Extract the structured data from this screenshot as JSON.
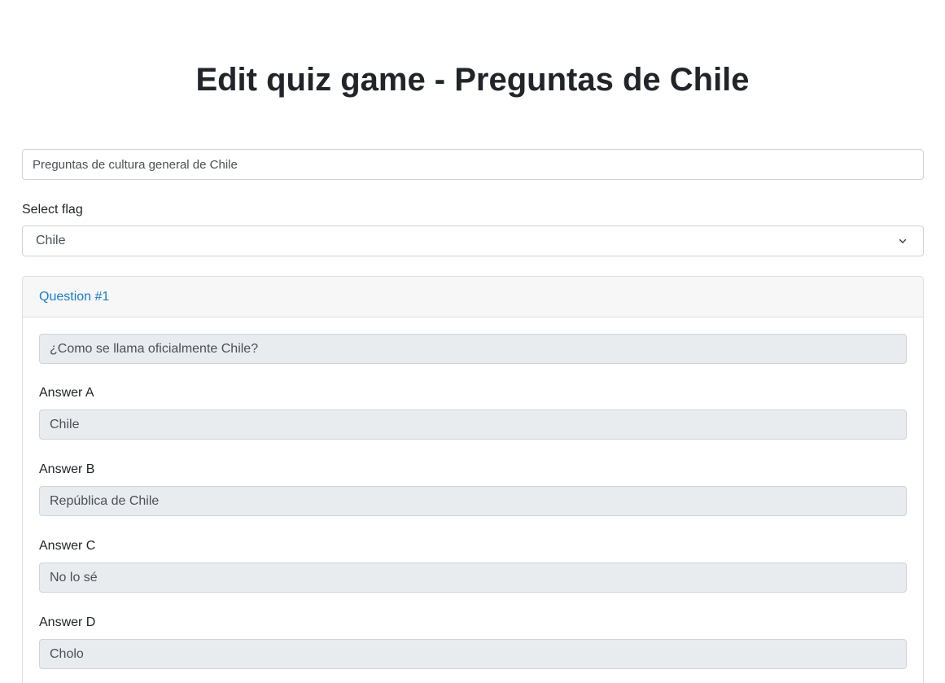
{
  "page": {
    "title": "Edit quiz game - Preguntas de Chile"
  },
  "form": {
    "description_value": "Preguntas de cultura general de Chile",
    "flag_label": "Select flag",
    "flag_selected": "Chile"
  },
  "question": {
    "header": "Question #1",
    "text": "¿Como se llama oficialmente Chile?",
    "answers": [
      {
        "label": "Answer A",
        "value": "Chile"
      },
      {
        "label": "Answer B",
        "value": "República de Chile"
      },
      {
        "label": "Answer C",
        "value": "No lo sé"
      },
      {
        "label": "Answer D",
        "value": "Cholo"
      }
    ]
  }
}
